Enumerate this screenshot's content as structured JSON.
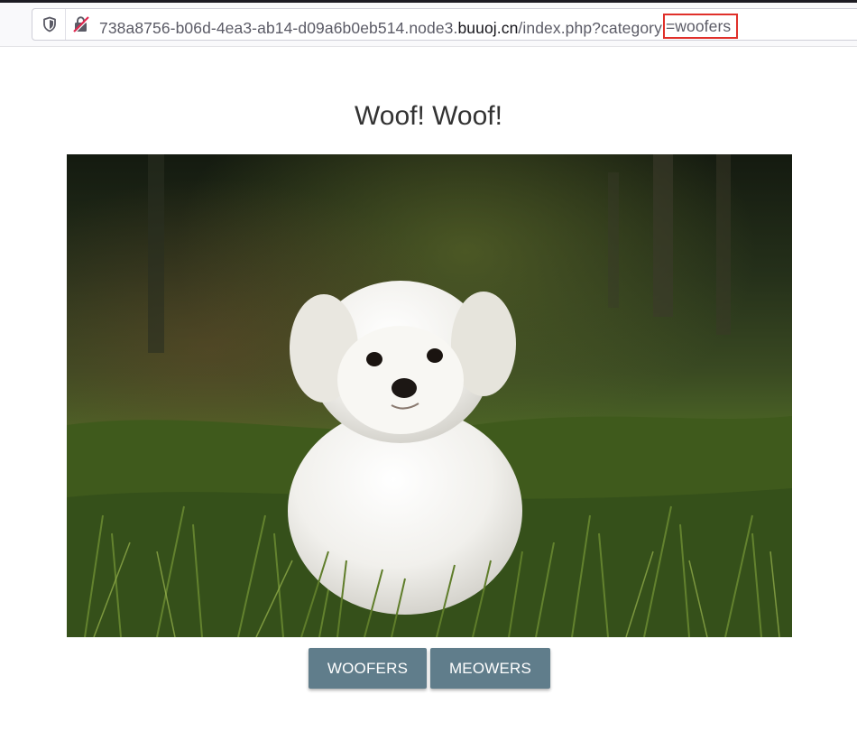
{
  "browser": {
    "url_prefix": "738a8756-b06d-4ea3-ab14-d09a6b0eb514.node3.",
    "url_domain": "buuoj.cn",
    "url_path": "/index.php?category",
    "url_highlight": "=woofers",
    "icons": [
      "shield-icon",
      "insecure-lock-icon"
    ],
    "highlight_color": "#e0302a"
  },
  "page": {
    "title": "Woof! Woof!",
    "hero_image": "white-puppy-in-grass"
  },
  "buttons": {
    "woofers": "WOOFERS",
    "meowers": "MEOWERS",
    "color": "#607d8b"
  }
}
